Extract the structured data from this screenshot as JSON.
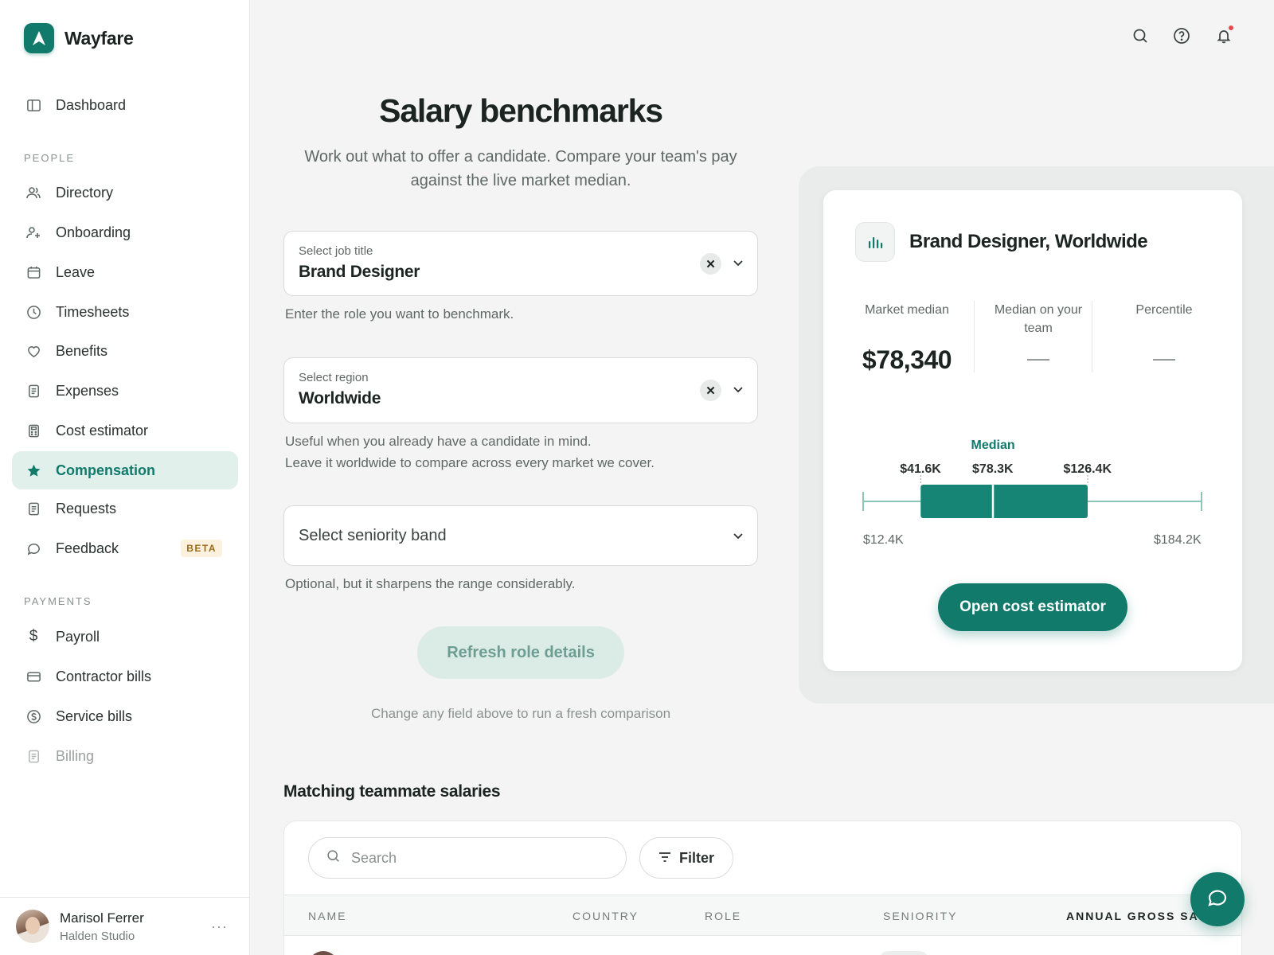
{
  "app": {
    "name": "Wayfare"
  },
  "nav": {
    "dashboard": "Dashboard",
    "people_section": "PEOPLE",
    "people": [
      {
        "label": "Directory"
      },
      {
        "label": "Onboarding"
      },
      {
        "label": "Leave"
      },
      {
        "label": "Timesheets"
      },
      {
        "label": "Benefits"
      },
      {
        "label": "Expenses"
      },
      {
        "label": "Cost estimator"
      },
      {
        "label": "Compensation"
      },
      {
        "label": "Requests"
      },
      {
        "label": "Feedback",
        "badge": "BETA"
      }
    ],
    "payments_section": "PAYMENTS",
    "payments": [
      {
        "label": "Payroll"
      },
      {
        "label": "Contractor bills"
      },
      {
        "label": "Service bills"
      },
      {
        "label": "Billing"
      }
    ],
    "active": "Compensation"
  },
  "user": {
    "name": "Marisol Ferrer",
    "org": "Halden Studio",
    "more": "···"
  },
  "page": {
    "title": "Salary benchmarks",
    "subtitle": "Work out what to offer a candidate. Compare your team's pay against the live market median."
  },
  "form": {
    "job": {
      "label": "Select job title",
      "value": "Brand Designer",
      "help": "Enter the role you want to benchmark."
    },
    "region": {
      "label": "Select region",
      "value": "Worldwide",
      "help_1": "Useful when you already have a candidate in mind.",
      "help_2": "Leave it worldwide to compare across every market we cover."
    },
    "seniority": {
      "placeholder": "Select seniority band",
      "help": "Optional, but it sharpens the range considerably."
    },
    "refresh_label": "Refresh role details",
    "refresh_hint": "Change any field above to run a fresh comparison"
  },
  "benchmark": {
    "title": "Brand Designer, Worldwide",
    "stats": {
      "market_median_label": "Market median",
      "market_median_value": "$78,340",
      "team_median_label": "Median on your team",
      "team_median_value": "—",
      "percentile_label": "Percentile",
      "percentile_value": "—"
    },
    "range": {
      "min": 12.4,
      "p25": 41.6,
      "median": 78.3,
      "p75": 126.4,
      "max": 184.2,
      "min_label": "$12.4K",
      "p25_label": "$41.6K",
      "median_label": "$78.3K",
      "p75_label": "$126.4K",
      "max_label": "$184.2K",
      "median_title": "Median"
    },
    "cta": "Open cost estimator"
  },
  "table": {
    "title": "Matching teammate salaries",
    "search_placeholder": "Search",
    "filter_label": "Filter",
    "columns": [
      "NAME",
      "COUNTRY",
      "ROLE",
      "SENIORITY",
      "ANNUAL GROSS SALA"
    ]
  },
  "colors": {
    "accent": "#117a6b",
    "accent_soft": "#e2f0ec"
  }
}
